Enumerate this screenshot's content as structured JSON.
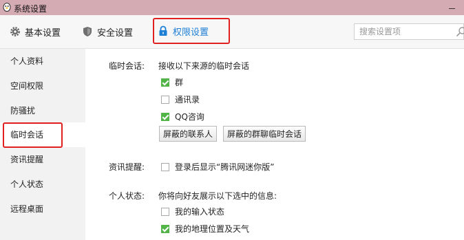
{
  "window": {
    "title": "系统设置"
  },
  "toolbar": {
    "tabs": [
      {
        "label": "基本设置",
        "icon": "gear-icon"
      },
      {
        "label": "安全设置",
        "icon": "shield-icon"
      },
      {
        "label": "权限设置",
        "icon": "lock-icon",
        "selected": true
      }
    ],
    "search_placeholder": "搜索设置项"
  },
  "sidebar": {
    "items": [
      {
        "label": "个人资料"
      },
      {
        "label": "空间权限"
      },
      {
        "label": "防骚扰"
      },
      {
        "label": "临时会话",
        "selected": true
      },
      {
        "label": "资讯提醒"
      },
      {
        "label": "个人状态"
      },
      {
        "label": "远程桌面"
      }
    ]
  },
  "content": {
    "temp_chat": {
      "label": "临时会话:",
      "desc": "接收以下来源的临时会话",
      "options": [
        {
          "label": "群",
          "checked": true
        },
        {
          "label": "通讯录",
          "checked": false
        },
        {
          "label": "QQ咨询",
          "checked": true
        }
      ],
      "buttons": [
        "屏蔽的联系人",
        "屏蔽的群聊临时会话"
      ]
    },
    "news": {
      "label": "资讯提醒:",
      "option": {
        "label": "登录后显示“腾讯网迷你版”",
        "checked": false
      }
    },
    "status": {
      "label": "个人状态:",
      "desc": "你将向好友展示以下选中的信息:",
      "options": [
        {
          "label": "我的输入状态",
          "checked": false
        },
        {
          "label": "我的地理位置及天气",
          "checked": true
        }
      ]
    }
  },
  "colors": {
    "accent": "#1e7fd6",
    "highlight_box": "#e02020",
    "check_green": "#52b447",
    "titlebar": "#d4aab3"
  }
}
